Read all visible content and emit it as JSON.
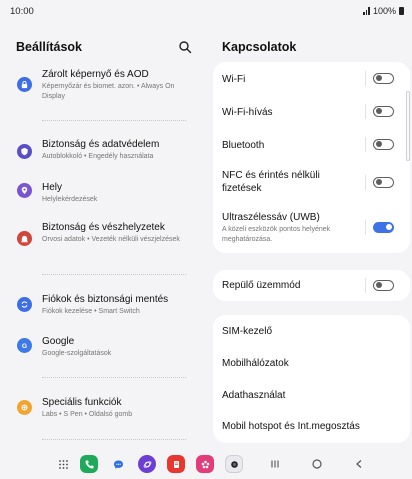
{
  "status": {
    "time": "10:00",
    "battery": "100%"
  },
  "left": {
    "title": "Beállítások",
    "items": [
      {
        "title": "Zárolt képernyő és AOD",
        "subtitle": "Képernyőzár és biomet. azon.  •  Always On Display",
        "icon": "lock-icon",
        "color": "#3d6ee6"
      },
      {
        "title": "Biztonság és adatvédelem",
        "subtitle": "Autoblokkoló  •  Engedély használata",
        "icon": "shield-icon",
        "color": "#5b4fc8"
      },
      {
        "title": "Hely",
        "subtitle": "Helylekérdezések",
        "icon": "location-pin-icon",
        "color": "#7a55d1"
      },
      {
        "title": "Biztonság és vészhelyzetek",
        "subtitle": "Orvosi adatok  •  Vezeték nélküli vészjelzések",
        "icon": "emergency-icon",
        "color": "#d1453b"
      },
      {
        "title": "Fiókok és biztonsági mentés",
        "subtitle": "Fiókok kezelése  •  Smart Switch",
        "icon": "sync-icon",
        "color": "#3d6ee6"
      },
      {
        "title": "Google",
        "subtitle": "Google-szolgáltatások",
        "icon": "google-icon",
        "color": "#3d7ae8"
      },
      {
        "title": "Speciális funkciók",
        "subtitle": "Labs  •  S Pen  •  Oldalsó gomb",
        "icon": "gear-plus-icon",
        "color": "#f0a431"
      }
    ]
  },
  "right": {
    "title": "Kapcsolatok",
    "card1": [
      {
        "label": "Wi-Fi",
        "toggle": false
      },
      {
        "label": "Wi-Fi-hívás",
        "toggle": false
      },
      {
        "label": "Bluetooth",
        "toggle": false
      },
      {
        "label": "NFC és érintés nélküli fizetések",
        "toggle": false
      },
      {
        "label": "Ultraszélessáv (UWB)",
        "subtitle": "A közeli eszközök pontos helyének meghatározása.",
        "toggle": true
      }
    ],
    "card2": [
      {
        "label": "Repülő üzemmód",
        "toggle": false
      }
    ],
    "card3": [
      {
        "label": "SIM-kezelő"
      },
      {
        "label": "Mobilhálózatok"
      },
      {
        "label": "Adathasználat"
      },
      {
        "label": "Mobil hotspot és Int.megosztás"
      }
    ]
  },
  "nav": {
    "apps": [
      "app-drawer-icon",
      "phone-icon",
      "messages-icon",
      "internet-icon",
      "notes-icon",
      "gallery-icon",
      "camera-icon"
    ],
    "buttons": [
      "recents-icon",
      "home-icon",
      "back-icon"
    ]
  },
  "colors": {
    "accent": "#3e73e8",
    "background": "#f4f4f6",
    "card": "#ffffff"
  }
}
